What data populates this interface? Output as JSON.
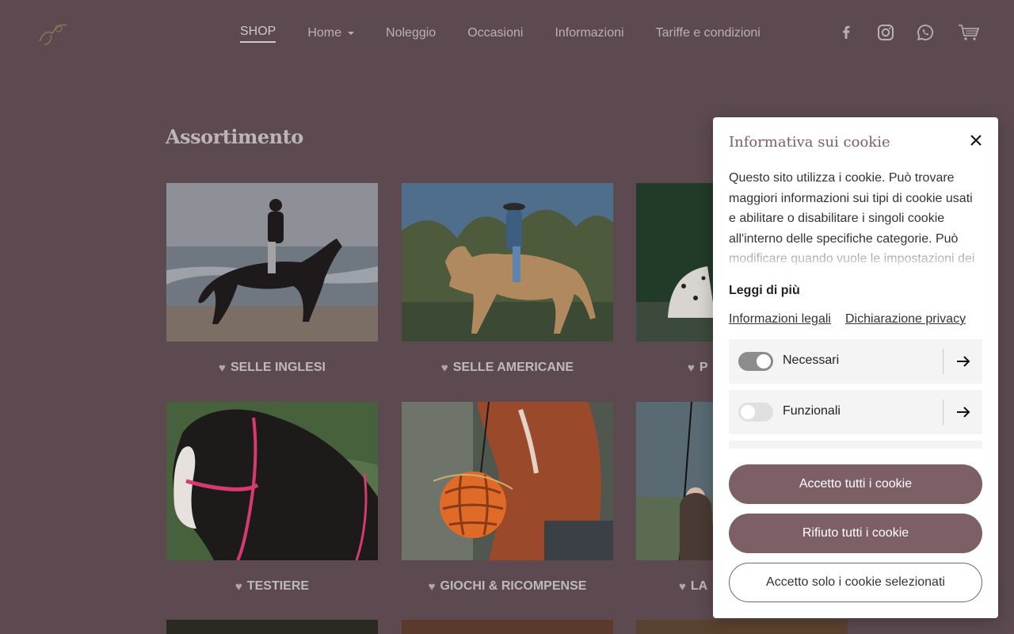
{
  "nav": {
    "items": [
      {
        "label": "SHOP",
        "active": true
      },
      {
        "label": "Home",
        "dropdown": true
      },
      {
        "label": "Noleggio"
      },
      {
        "label": "Occasioni"
      },
      {
        "label": "Informazioni"
      },
      {
        "label": "Tariffe e condizioni"
      }
    ],
    "social_icons": [
      "facebook-icon",
      "instagram-icon",
      "whatsapp-icon",
      "cart-icon"
    ]
  },
  "main": {
    "title": "Assortimento",
    "categories": [
      {
        "label": "SELLE INGLESI",
        "icon": "heart-icon"
      },
      {
        "label": "SELLE AMERICANE",
        "icon": "heart-icon"
      },
      {
        "label": "P",
        "icon": "heart-icon"
      },
      {
        "label": "TESTIERE",
        "icon": "heart-icon"
      },
      {
        "label": "GIOCHI & RICOMPENSE",
        "icon": "heart-icon"
      },
      {
        "label": "LA",
        "icon": "heart-icon"
      }
    ]
  },
  "cookie": {
    "title": "Informativa sui cookie",
    "text": "Questo sito utilizza i cookie. Può trovare maggiori informazioni sui tipi di cookie usati e abilitare o disabilitare i singoli cookie all'interno delle specifiche categorie. Può modificare quando vuole le impostazioni dei",
    "read_more": "Leggi di più",
    "links": [
      "Informazioni legali",
      "Dichiarazione privacy"
    ],
    "categories": [
      {
        "label": "Necessari",
        "enabled": true
      },
      {
        "label": "Funzionali",
        "enabled": false
      }
    ],
    "buttons": {
      "accept_all": "Accetto tutti i cookie",
      "reject_all": "Rifiuto tutti i cookie",
      "accept_selected": "Accetto solo i cookie selezionati"
    }
  },
  "colors": {
    "overlay_bg": "#5c4a50",
    "brand": "#7d5f66"
  }
}
